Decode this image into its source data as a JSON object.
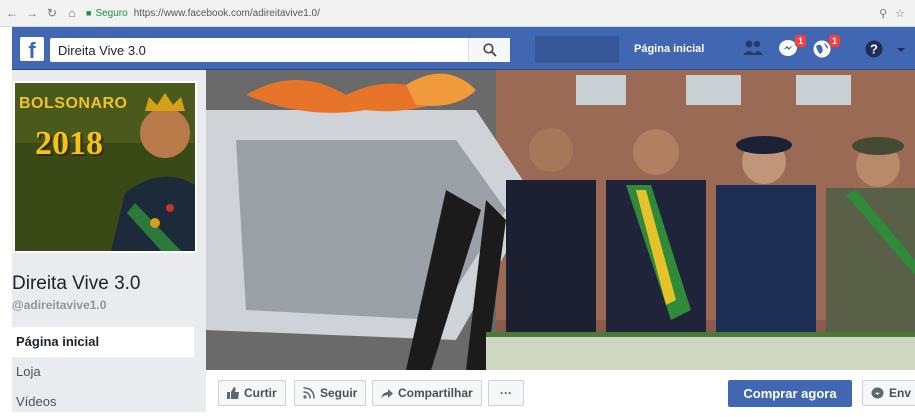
{
  "browser": {
    "secure_label": "Seguro",
    "url": "https://www.facebook.com/adireitavive1.0/"
  },
  "topbar": {
    "search_value": "Direita Vive 3.0",
    "home_label": "Página inicial",
    "messages_badge": "1",
    "notifications_badge": "1",
    "brand_color": "#4267b2"
  },
  "profile": {
    "image_text_line1": "BOLSONARO",
    "image_text_line2": "2018",
    "name": "Direita Vive 3.0",
    "handle": "@adireitavive1.0"
  },
  "sidebar": {
    "items": [
      {
        "label": "Página inicial",
        "active": true
      },
      {
        "label": "Loja",
        "active": false
      },
      {
        "label": "Vídeos",
        "active": false
      }
    ]
  },
  "actions": {
    "like": "Curtir",
    "follow": "Seguir",
    "share": "Compartilhar",
    "more": "···",
    "buy": "Comprar agora",
    "send": "Env"
  }
}
